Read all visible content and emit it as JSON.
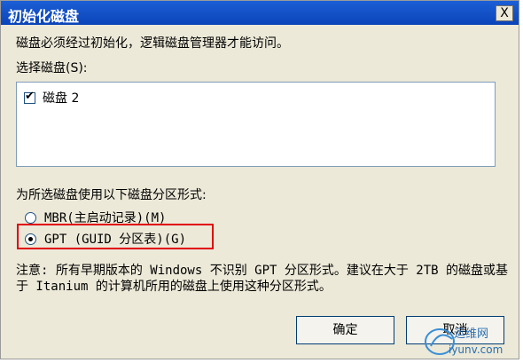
{
  "window": {
    "title": "初始化磁盘",
    "close_label": "X"
  },
  "message": "磁盘必须经过初始化，逻辑磁盘管理器才能访问。",
  "disk_list": {
    "label": "选择磁盘(S):",
    "items": [
      {
        "label": "磁盘 2",
        "checked": true
      }
    ]
  },
  "partition": {
    "label": "为所选磁盘使用以下磁盘分区形式:",
    "options": [
      {
        "label": "MBR(主启动记录)(M)",
        "selected": false
      },
      {
        "label": "GPT (GUID 分区表)(G)",
        "selected": true
      }
    ]
  },
  "note": "注意: 所有早期版本的 Windows 不识别 GPT 分区形式。建议在大于 2TB 的磁盘或基于 Itanium 的计算机所用的磁盘上使用这种分区形式。",
  "buttons": {
    "ok": "确定",
    "cancel": "取消"
  },
  "watermark": {
    "text_cn": "运维网",
    "text_en": "iyunv.com"
  },
  "colors": {
    "highlight": "#e0000b",
    "titlebar": "#0b44b9"
  }
}
